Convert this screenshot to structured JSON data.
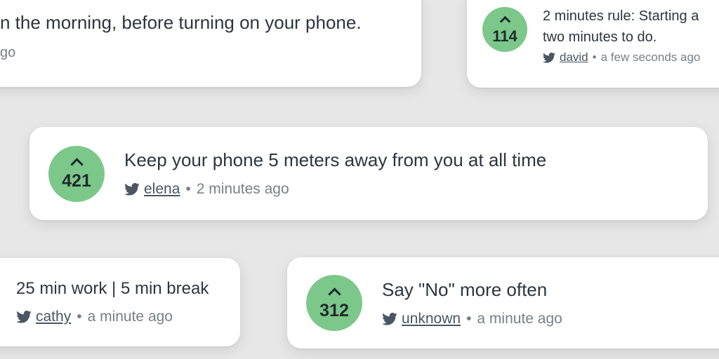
{
  "colors": {
    "background": "#e7e7e7",
    "card": "#ffffff",
    "vote_badge": "#7cc88a",
    "text": "#2e3540",
    "meta": "#7a7f87"
  },
  "icons": {
    "social": "twitter-bird-icon",
    "upvote": "chevron-up-icon"
  },
  "tips": [
    {
      "text": "n the morning, before turning on your phone.",
      "time": "go"
    },
    {
      "votes": "114",
      "text_line1": "2 minutes rule: Starting a",
      "text_line2": "two minutes to do.",
      "user": "david",
      "separator": "•",
      "time": "a few seconds ago"
    },
    {
      "votes": "421",
      "text": "Keep your phone 5 meters away from you at all time",
      "user": "elena",
      "separator": "•",
      "time": "2 minutes ago"
    },
    {
      "text": "25 min work | 5 min break",
      "user": "cathy",
      "separator": "•",
      "time": "a minute ago"
    },
    {
      "votes": "312",
      "text": "Say \"No\" more often",
      "user": "unknown",
      "separator": "•",
      "time": "a minute ago"
    }
  ]
}
